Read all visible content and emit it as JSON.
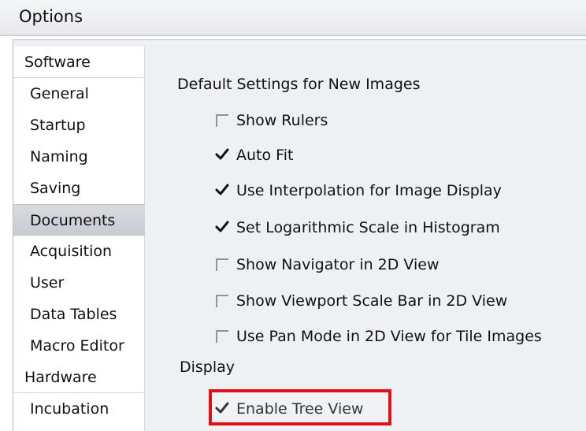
{
  "window": {
    "title": "Options"
  },
  "sidebar": {
    "groups": [
      {
        "label": "Software",
        "items": [
          "General",
          "Startup",
          "Naming",
          "Saving",
          "Documents",
          "Acquisition",
          "User",
          "Data Tables",
          "Macro Editor"
        ],
        "selected_item": "Documents"
      },
      {
        "label": "Hardware",
        "items": [
          "Incubation"
        ]
      }
    ]
  },
  "settings": {
    "default_images": {
      "title": "Default Settings for New Images",
      "options": [
        {
          "label": "Show Rulers",
          "checked": false
        },
        {
          "label": "Auto Fit",
          "checked": true
        },
        {
          "label": "Use Interpolation for Image Display",
          "checked": true
        },
        {
          "label": "Set Logarithmic Scale in Histogram",
          "checked": true
        },
        {
          "label": "Show Navigator in 2D View",
          "checked": false
        },
        {
          "label": "Show Viewport Scale Bar in 2D View",
          "checked": false
        },
        {
          "label": "Use Pan Mode in 2D View for Tile Images",
          "checked": false
        }
      ]
    },
    "display": {
      "title": "Display",
      "options": [
        {
          "label": "Enable Tree View",
          "checked": true
        }
      ]
    }
  },
  "colors": {
    "highlight_border": "#e0101a"
  }
}
